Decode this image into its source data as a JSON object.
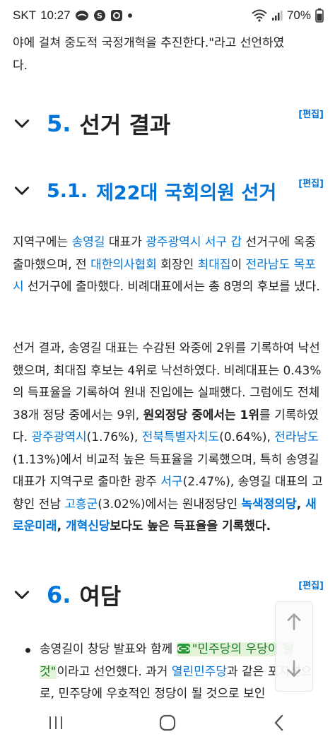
{
  "status_bar": {
    "carrier": "SKT",
    "time": "10:27",
    "battery": "70%",
    "icons": [
      "messenger-icon",
      "samsung-icon",
      "signal-s-icon",
      "notification-dot-icon",
      "wifi-icon",
      "cell-signal-icon",
      "battery-icon"
    ]
  },
  "article": {
    "intro_line1": "야에 걸쳐 중도적 국정개혁을 추진한다.\"라고 선언하였",
    "intro_line2": "다.",
    "section5": {
      "num": "5.",
      "title": "선거 결과",
      "edit": "[편집]"
    },
    "section51": {
      "num": "5.1.",
      "title": "제22대 국회의원 선거",
      "edit": "[편집]"
    },
    "p1": {
      "t1": "지역구에는 ",
      "l1": "송영길",
      "t2": " 대표가 ",
      "l2": "광주광역시 서구 갑",
      "t3": " 선거구에 옥중 출마했으며, 전 ",
      "l3": "대한의사협회",
      "t4": " 회장인 ",
      "l4": "최대집",
      "t5": "이 ",
      "l5": "전라남도 목포시",
      "t6": " 선거구에 출마했다. 비례대표에서는 총 8명의 후보를 냈다."
    },
    "p2": {
      "t1": "선거 결과, 송영길 대표는 수감된 와중에 2위를 기록하여 낙선했으며, 최대집 후보는 4위로 낙선하였다. 비례대표는 0.43%의 득표율을 기록하여 원내 진입에는 실패했다. 그럼에도 전체 38개 정당 중에서는 9위, ",
      "b1": "원외정당 중에서는 1위",
      "t2": "를 기록하였다. ",
      "l1": "광주광역시",
      "t3": "(1.76%), ",
      "l2": "전북특별자치도",
      "t4": "(0.64%), ",
      "l3": "전라남도",
      "t5": "(1.13%)에서 비교적 높은 득표율을 기록했으며, 특히 송영길 대표가 지역구로 출마한 광주 ",
      "l4": "서구",
      "t6": "(2.47%), 송영길 대표의 고향인 전남 ",
      "l5": "고흥군",
      "t7": "(3.02%)에서는 원내정당인 ",
      "bl1": "녹색정의당",
      "bt1": ", ",
      "bl2": "새로운미래",
      "bt2": ", ",
      "bl3": "개혁신당",
      "b2": "보다도 높은 득표율을 기록했다."
    },
    "section6": {
      "num": "6.",
      "title": "여담",
      "edit": "[편집]"
    },
    "bullet1": {
      "t1": "송영길이 창당 발표와 함께 ",
      "hl": "\"민주당의 우당이 될 것\"",
      "t2": "이라고 선언했다. 과거 ",
      "l1": "열린민주당",
      "t3": "과 같은 포지션으로, 민주당에 우호적인 정당이 될 것으로 보인"
    }
  },
  "colors": {
    "link": "#0275d8",
    "text": "#222222",
    "quote_link": "#1a7a26"
  },
  "nav_bar": {
    "buttons": [
      "recent-apps-icon",
      "home-icon",
      "back-icon"
    ]
  }
}
